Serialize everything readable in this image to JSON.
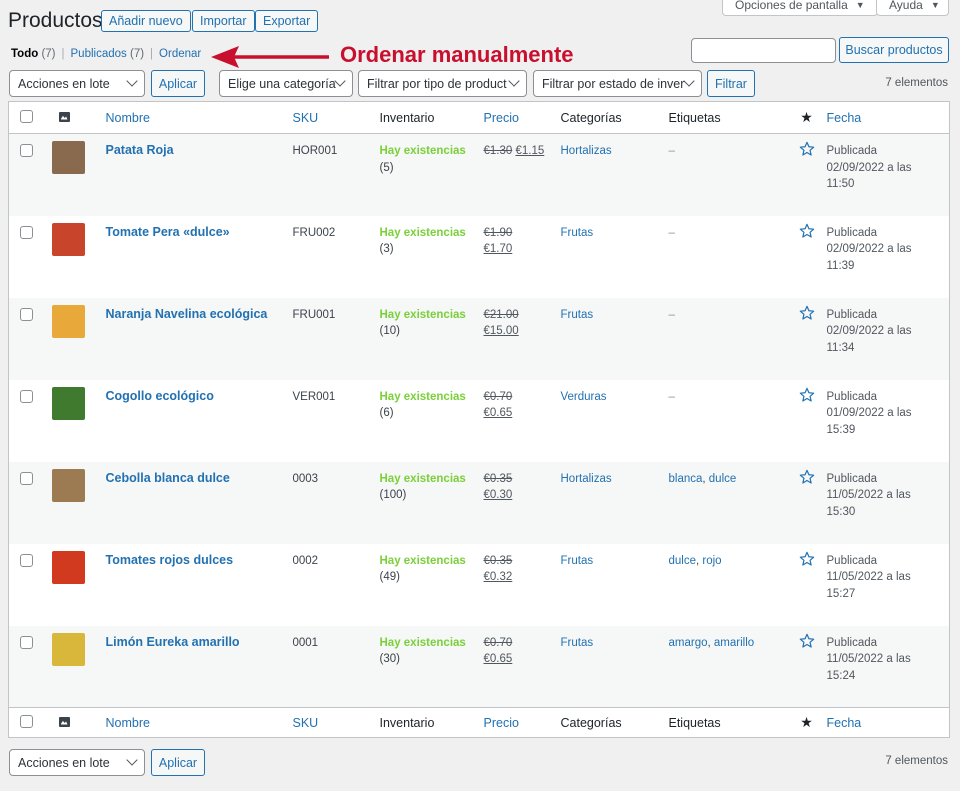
{
  "header": {
    "title": "Productos",
    "buttons": {
      "add_new": "Añadir nuevo",
      "import": "Importar",
      "export": "Exportar"
    },
    "screen_options": "Opciones de pantalla",
    "help": "Ayuda"
  },
  "views": {
    "all": "Todo",
    "all_count": "(7)",
    "published": "Publicados",
    "published_count": "(7)",
    "sort": "Ordenar"
  },
  "annotation": {
    "text": "Ordenar manualmente",
    "color": "#c8102e"
  },
  "search": {
    "value": "",
    "button": "Buscar productos"
  },
  "filters": {
    "bulk_actions": "Acciones en lote",
    "apply": "Aplicar",
    "category": "Elige una categoría",
    "product_type": "Filtrar por tipo de product",
    "stock_status": "Filtrar por estado de inver",
    "filter": "Filtrar"
  },
  "items_count": "7 elementos",
  "columns": {
    "name": "Nombre",
    "sku": "SKU",
    "stock": "Inventario",
    "price": "Precio",
    "categories": "Categorías",
    "tags": "Etiquetas",
    "date": "Fecha"
  },
  "products": [
    {
      "name": "Patata Roja",
      "sku": "HOR001",
      "stock": "Hay existencias",
      "qty": "(5)",
      "old_price": "€1.30",
      "price": "€1.15",
      "category": "Hortalizas",
      "tags": [
        "–"
      ],
      "status": "Publicada",
      "date": "02/09/2022 a las",
      "time": "11:50",
      "thumb_color": "#8a6a4e"
    },
    {
      "name": "Tomate Pera «dulce»",
      "sku": "FRU002",
      "stock": "Hay existencias",
      "qty": "(3)",
      "old_price": "€1.90",
      "price": "€1.70",
      "category": "Frutas",
      "tags": [
        "–"
      ],
      "status": "Publicada",
      "date": "02/09/2022 a las",
      "time": "11:39",
      "thumb_color": "#c8442a"
    },
    {
      "name": "Naranja Navelina ecológica",
      "sku": "FRU001",
      "stock": "Hay existencias",
      "qty": "(10)",
      "old_price": "€21.00",
      "price": "€15.00",
      "category": "Frutas",
      "tags": [
        "–"
      ],
      "status": "Publicada",
      "date": "02/09/2022 a las",
      "time": "11:34",
      "thumb_color": "#e8a93a"
    },
    {
      "name": "Cogollo ecológico",
      "sku": "VER001",
      "stock": "Hay existencias",
      "qty": "(6)",
      "old_price": "€0.70",
      "price": "€0.65",
      "category": "Verduras",
      "tags": [
        "–"
      ],
      "status": "Publicada",
      "date": "01/09/2022 a las",
      "time": "15:39",
      "thumb_color": "#3f7a2e"
    },
    {
      "name": "Cebolla blanca dulce",
      "sku": "0003",
      "stock": "Hay existencias",
      "qty": "(100)",
      "old_price": "€0.35",
      "price": "€0.30",
      "category": "Hortalizas",
      "tags": [
        "blanca",
        "dulce"
      ],
      "status": "Publicada",
      "date": "11/05/2022 a las",
      "time": "15:30",
      "thumb_color": "#9c7a52"
    },
    {
      "name": "Tomates rojos dulces",
      "sku": "0002",
      "stock": "Hay existencias",
      "qty": "(49)",
      "old_price": "€0.35",
      "price": "€0.32",
      "category": "Frutas",
      "tags": [
        "dulce",
        "rojo"
      ],
      "status": "Publicada",
      "date": "11/05/2022 a las",
      "time": "15:27",
      "thumb_color": "#d23a1f"
    },
    {
      "name": "Limón Eureka amarillo",
      "sku": "0001",
      "stock": "Hay existencias",
      "qty": "(30)",
      "old_price": "€0.70",
      "price": "€0.65",
      "category": "Frutas",
      "tags": [
        "amargo",
        "amarillo"
      ],
      "status": "Publicada",
      "date": "11/05/2022 a las",
      "time": "15:24",
      "thumb_color": "#d9b73a"
    }
  ],
  "colors": {
    "link": "#2271b1",
    "in_stock": "#7ad03a",
    "annotation": "#c8102e"
  }
}
